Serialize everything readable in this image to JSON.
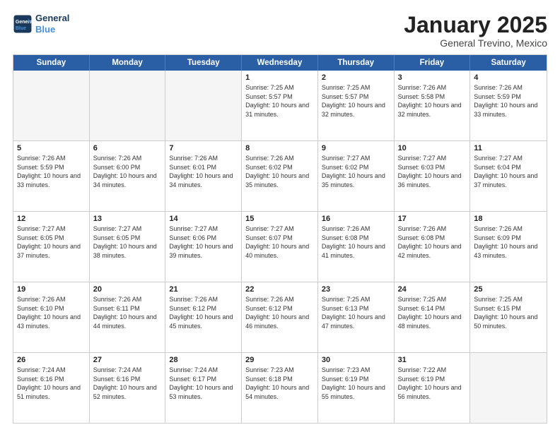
{
  "header": {
    "logo_line1": "General",
    "logo_line2": "Blue",
    "month": "January 2025",
    "location": "General Trevino, Mexico"
  },
  "days": [
    "Sunday",
    "Monday",
    "Tuesday",
    "Wednesday",
    "Thursday",
    "Friday",
    "Saturday"
  ],
  "rows": [
    [
      {
        "date": "",
        "sunrise": "",
        "sunset": "",
        "daylight": "",
        "empty": true
      },
      {
        "date": "",
        "sunrise": "",
        "sunset": "",
        "daylight": "",
        "empty": true
      },
      {
        "date": "",
        "sunrise": "",
        "sunset": "",
        "daylight": "",
        "empty": true
      },
      {
        "date": "1",
        "sunrise": "Sunrise: 7:25 AM",
        "sunset": "Sunset: 5:57 PM",
        "daylight": "Daylight: 10 hours and 31 minutes.",
        "empty": false
      },
      {
        "date": "2",
        "sunrise": "Sunrise: 7:25 AM",
        "sunset": "Sunset: 5:57 PM",
        "daylight": "Daylight: 10 hours and 32 minutes.",
        "empty": false
      },
      {
        "date": "3",
        "sunrise": "Sunrise: 7:26 AM",
        "sunset": "Sunset: 5:58 PM",
        "daylight": "Daylight: 10 hours and 32 minutes.",
        "empty": false
      },
      {
        "date": "4",
        "sunrise": "Sunrise: 7:26 AM",
        "sunset": "Sunset: 5:59 PM",
        "daylight": "Daylight: 10 hours and 33 minutes.",
        "empty": false
      }
    ],
    [
      {
        "date": "5",
        "sunrise": "Sunrise: 7:26 AM",
        "sunset": "Sunset: 5:59 PM",
        "daylight": "Daylight: 10 hours and 33 minutes.",
        "empty": false
      },
      {
        "date": "6",
        "sunrise": "Sunrise: 7:26 AM",
        "sunset": "Sunset: 6:00 PM",
        "daylight": "Daylight: 10 hours and 34 minutes.",
        "empty": false
      },
      {
        "date": "7",
        "sunrise": "Sunrise: 7:26 AM",
        "sunset": "Sunset: 6:01 PM",
        "daylight": "Daylight: 10 hours and 34 minutes.",
        "empty": false
      },
      {
        "date": "8",
        "sunrise": "Sunrise: 7:26 AM",
        "sunset": "Sunset: 6:02 PM",
        "daylight": "Daylight: 10 hours and 35 minutes.",
        "empty": false
      },
      {
        "date": "9",
        "sunrise": "Sunrise: 7:27 AM",
        "sunset": "Sunset: 6:02 PM",
        "daylight": "Daylight: 10 hours and 35 minutes.",
        "empty": false
      },
      {
        "date": "10",
        "sunrise": "Sunrise: 7:27 AM",
        "sunset": "Sunset: 6:03 PM",
        "daylight": "Daylight: 10 hours and 36 minutes.",
        "empty": false
      },
      {
        "date": "11",
        "sunrise": "Sunrise: 7:27 AM",
        "sunset": "Sunset: 6:04 PM",
        "daylight": "Daylight: 10 hours and 37 minutes.",
        "empty": false
      }
    ],
    [
      {
        "date": "12",
        "sunrise": "Sunrise: 7:27 AM",
        "sunset": "Sunset: 6:05 PM",
        "daylight": "Daylight: 10 hours and 37 minutes.",
        "empty": false
      },
      {
        "date": "13",
        "sunrise": "Sunrise: 7:27 AM",
        "sunset": "Sunset: 6:05 PM",
        "daylight": "Daylight: 10 hours and 38 minutes.",
        "empty": false
      },
      {
        "date": "14",
        "sunrise": "Sunrise: 7:27 AM",
        "sunset": "Sunset: 6:06 PM",
        "daylight": "Daylight: 10 hours and 39 minutes.",
        "empty": false
      },
      {
        "date": "15",
        "sunrise": "Sunrise: 7:27 AM",
        "sunset": "Sunset: 6:07 PM",
        "daylight": "Daylight: 10 hours and 40 minutes.",
        "empty": false
      },
      {
        "date": "16",
        "sunrise": "Sunrise: 7:26 AM",
        "sunset": "Sunset: 6:08 PM",
        "daylight": "Daylight: 10 hours and 41 minutes.",
        "empty": false
      },
      {
        "date": "17",
        "sunrise": "Sunrise: 7:26 AM",
        "sunset": "Sunset: 6:08 PM",
        "daylight": "Daylight: 10 hours and 42 minutes.",
        "empty": false
      },
      {
        "date": "18",
        "sunrise": "Sunrise: 7:26 AM",
        "sunset": "Sunset: 6:09 PM",
        "daylight": "Daylight: 10 hours and 43 minutes.",
        "empty": false
      }
    ],
    [
      {
        "date": "19",
        "sunrise": "Sunrise: 7:26 AM",
        "sunset": "Sunset: 6:10 PM",
        "daylight": "Daylight: 10 hours and 43 minutes.",
        "empty": false
      },
      {
        "date": "20",
        "sunrise": "Sunrise: 7:26 AM",
        "sunset": "Sunset: 6:11 PM",
        "daylight": "Daylight: 10 hours and 44 minutes.",
        "empty": false
      },
      {
        "date": "21",
        "sunrise": "Sunrise: 7:26 AM",
        "sunset": "Sunset: 6:12 PM",
        "daylight": "Daylight: 10 hours and 45 minutes.",
        "empty": false
      },
      {
        "date": "22",
        "sunrise": "Sunrise: 7:26 AM",
        "sunset": "Sunset: 6:12 PM",
        "daylight": "Daylight: 10 hours and 46 minutes.",
        "empty": false
      },
      {
        "date": "23",
        "sunrise": "Sunrise: 7:25 AM",
        "sunset": "Sunset: 6:13 PM",
        "daylight": "Daylight: 10 hours and 47 minutes.",
        "empty": false
      },
      {
        "date": "24",
        "sunrise": "Sunrise: 7:25 AM",
        "sunset": "Sunset: 6:14 PM",
        "daylight": "Daylight: 10 hours and 48 minutes.",
        "empty": false
      },
      {
        "date": "25",
        "sunrise": "Sunrise: 7:25 AM",
        "sunset": "Sunset: 6:15 PM",
        "daylight": "Daylight: 10 hours and 50 minutes.",
        "empty": false
      }
    ],
    [
      {
        "date": "26",
        "sunrise": "Sunrise: 7:24 AM",
        "sunset": "Sunset: 6:16 PM",
        "daylight": "Daylight: 10 hours and 51 minutes.",
        "empty": false
      },
      {
        "date": "27",
        "sunrise": "Sunrise: 7:24 AM",
        "sunset": "Sunset: 6:16 PM",
        "daylight": "Daylight: 10 hours and 52 minutes.",
        "empty": false
      },
      {
        "date": "28",
        "sunrise": "Sunrise: 7:24 AM",
        "sunset": "Sunset: 6:17 PM",
        "daylight": "Daylight: 10 hours and 53 minutes.",
        "empty": false
      },
      {
        "date": "29",
        "sunrise": "Sunrise: 7:23 AM",
        "sunset": "Sunset: 6:18 PM",
        "daylight": "Daylight: 10 hours and 54 minutes.",
        "empty": false
      },
      {
        "date": "30",
        "sunrise": "Sunrise: 7:23 AM",
        "sunset": "Sunset: 6:19 PM",
        "daylight": "Daylight: 10 hours and 55 minutes.",
        "empty": false
      },
      {
        "date": "31",
        "sunrise": "Sunrise: 7:22 AM",
        "sunset": "Sunset: 6:19 PM",
        "daylight": "Daylight: 10 hours and 56 minutes.",
        "empty": false
      },
      {
        "date": "",
        "sunrise": "",
        "sunset": "",
        "daylight": "",
        "empty": true
      }
    ]
  ]
}
